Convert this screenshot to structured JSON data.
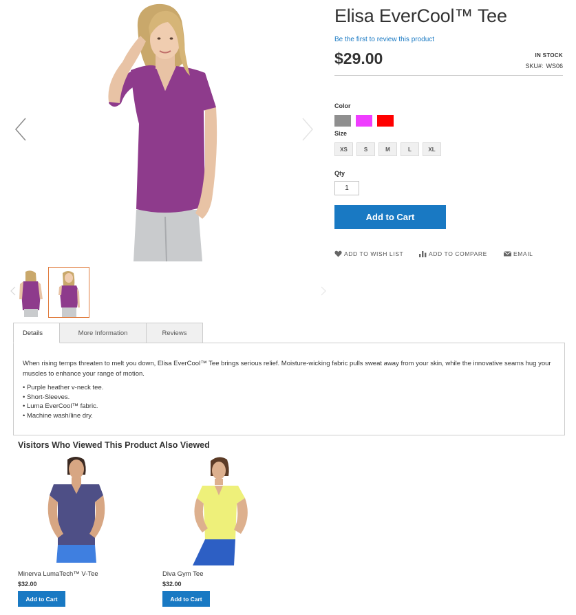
{
  "product": {
    "title": "Elisa EverCool™ Tee",
    "review_link": "Be the first to review this product",
    "price": "$29.00",
    "stock": "IN STOCK",
    "sku_label": "SKU#:",
    "sku_value": "WS06"
  },
  "options": {
    "color_label": "Color",
    "colors": [
      "#8f8f8f",
      "#ef3dff",
      "#ff0000"
    ],
    "size_label": "Size",
    "sizes": [
      "XS",
      "S",
      "M",
      "L",
      "XL"
    ],
    "qty_label": "Qty",
    "qty_value": "1"
  },
  "buttons": {
    "add_to_cart": "Add to Cart"
  },
  "actions": {
    "wishlist": "ADD TO WISH LIST",
    "compare": "ADD TO COMPARE",
    "email": "EMAIL"
  },
  "tabs": {
    "items": [
      "Details",
      "More Information",
      "Reviews"
    ],
    "active": "Details",
    "description": "When rising temps threaten to melt you down, Elisa EverCool™ Tee brings serious relief. Moisture-wicking fabric pulls sweat away from your skin, while the innovative seams hug your muscles to enhance your range of motion.",
    "bullets": [
      "• Purple heather v-neck tee.",
      "• Short-Sleeves.",
      "• Luma EverCool™ fabric.",
      "• Machine wash/line dry."
    ]
  },
  "related": {
    "title": "Visitors Who Viewed This Product Also Viewed",
    "items": [
      {
        "name": "Minerva LumaTech™ V-Tee",
        "price": "$32.00",
        "button": "Add to Cart"
      },
      {
        "name": "Diva Gym Tee",
        "price": "$32.00",
        "button": "Add to Cart"
      }
    ]
  },
  "colors": {
    "accent": "#1979c3",
    "thumb_active_border": "#e07b3c",
    "product_shirt": "#8e3b8c"
  },
  "icons": [
    "chevron-left-icon",
    "chevron-right-icon",
    "heart-icon",
    "compare-bars-icon",
    "envelope-icon"
  ]
}
